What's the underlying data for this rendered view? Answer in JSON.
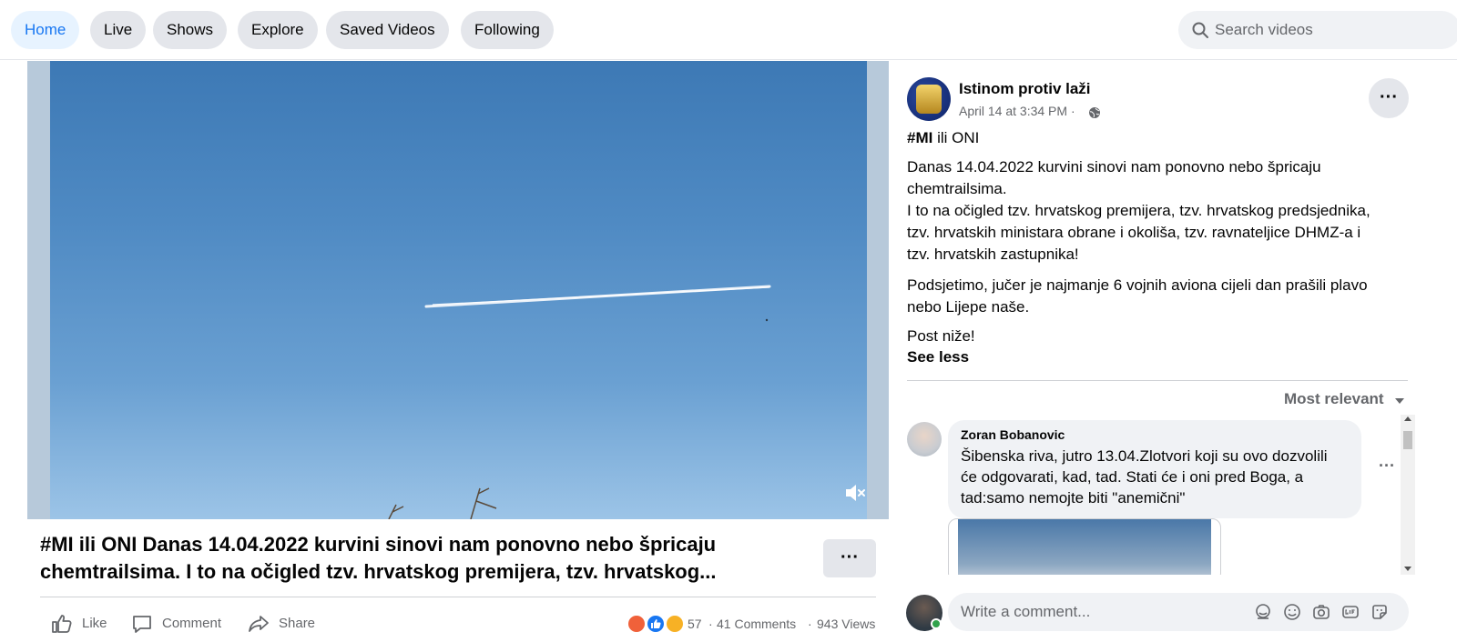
{
  "nav": {
    "tabs": [
      {
        "label": "Home",
        "active": true
      },
      {
        "label": "Live"
      },
      {
        "label": "Shows"
      },
      {
        "label": "Explore"
      },
      {
        "label": "Saved Videos"
      },
      {
        "label": "Following"
      }
    ],
    "search_placeholder": "Search videos"
  },
  "video": {
    "title_line1": "#MI ili ONI Danas 14.04.2022 kurvini sinovi nam ponovno nebo špricaju",
    "title_line2": "chemtrailsima. I to na očigled tzv. hrvatskog premijera, tzv. hrvatskog...",
    "more": "···",
    "actions": {
      "like": "Like",
      "comment": "Comment",
      "share": "Share"
    },
    "reactions_count": "57",
    "comments_count": "41 Comments",
    "views": "943 Views",
    "separator": "·"
  },
  "post": {
    "page_name": "Istinom protiv laži",
    "meta": "April 14 at 3:34 PM ·",
    "more": "···",
    "hashtag": "#MI",
    "hashtag_rest": " ili ONI",
    "p1_line1": "Danas 14.04.2022 kurvini sinovi nam ponovno nebo špricaju",
    "p1_line2": "chemtrailsima.",
    "p1_line3": "I to na očigled tzv. hrvatskog premijera, tzv. hrvatskog predsjednika,",
    "p1_line4": "tzv. hrvatskih ministara obrane i okoliša, tzv. ravnateljice DHMZ-a i",
    "p1_line5": "tzv. hrvatskih zastupnika!",
    "p2_line1": "Podsjetimo, jučer je najmanje 6 vojnih aviona cijeli dan prašili plavo",
    "p2_line2": "nebo Lijepe naše.",
    "p3": "Post niže!",
    "see_less": "See less"
  },
  "comments": {
    "sort_label": "Most relevant",
    "items": [
      {
        "author": "Zoran Bobanovic",
        "line1": "Šibenska riva, jutro 13.04.Zlotvori koji su ovo dozvolili",
        "line2": "će odgovarati, kad, tad. Stati će i oni pred Boga, a",
        "line3": "tad:samo nemojte biti \"anemični\""
      }
    ],
    "more": "···",
    "write_placeholder": "Write a comment..."
  },
  "colors": {
    "accent": "#1877f2",
    "tab_bg": "#e4e6eb",
    "active_tab_bg": "#e7f3ff",
    "muted_text": "#65676b",
    "online": "#31a24c"
  }
}
